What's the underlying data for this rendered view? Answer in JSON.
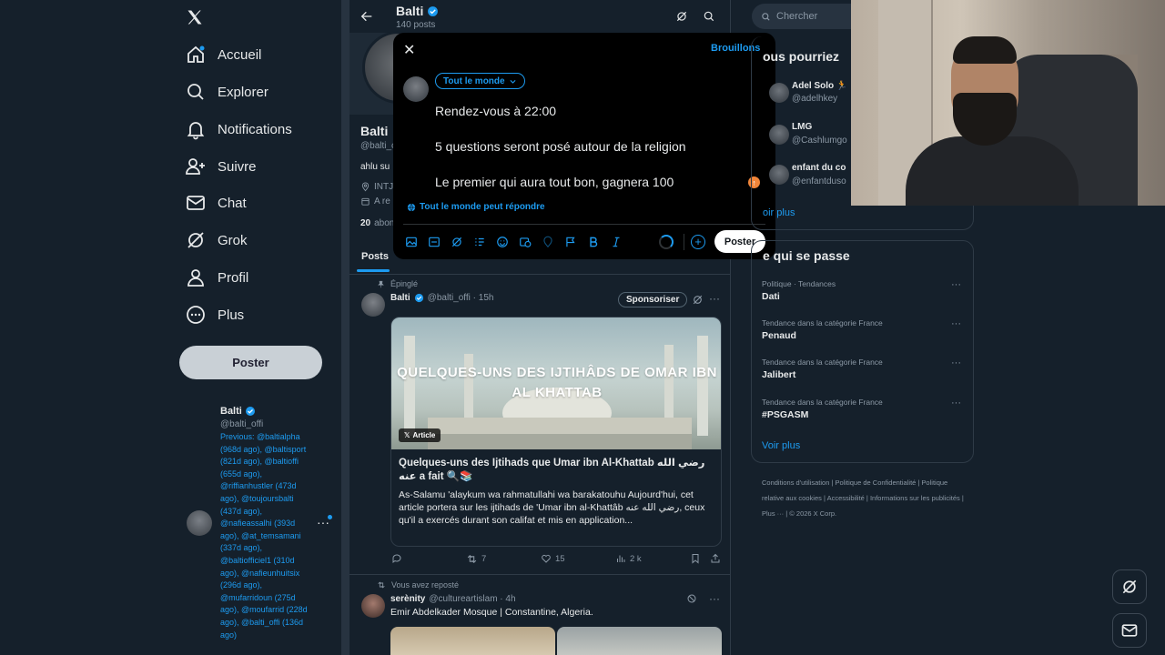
{
  "nav": {
    "items": [
      {
        "label": "Accueil",
        "icon": "home-icon"
      },
      {
        "label": "Explorer",
        "icon": "search-icon"
      },
      {
        "label": "Notifications",
        "icon": "bell-icon"
      },
      {
        "label": "Suivre",
        "icon": "add-person-icon"
      },
      {
        "label": "Chat",
        "icon": "mail-icon"
      },
      {
        "label": "Grok",
        "icon": "grok-icon"
      },
      {
        "label": "Profil",
        "icon": "person-icon"
      },
      {
        "label": "Plus",
        "icon": "more-circle-icon"
      }
    ],
    "post_button": "Poster"
  },
  "account": {
    "name": "Balti",
    "handle": "@balti_offi",
    "previous": "Previous: @baltialpha (968d ago), @baltisport (821d ago), @baltioffi (655d ago), @riffianhustler (473d ago), @toujoursbalti (437d ago), @nafieassalhi (393d ago), @at_temsamani (337d ago), @baltiofficiel1 (310d ago), @nafieunhuitsix (296d ago), @mufarridoun (275d ago), @moufarrid (228d ago), @balti_offi (136d ago)"
  },
  "profile": {
    "header_name": "Balti",
    "post_count": "140 posts",
    "display_name_partial": "Balti",
    "handle_partial": "@balti_c",
    "bio_partial": "ahlu su",
    "location_partial": "INTJ",
    "joined_partial": "A re",
    "following_partial": "20",
    "following_label_partial": "abon",
    "tab_posts": "Posts"
  },
  "compose": {
    "drafts": "Brouillons",
    "audience": "Tout le monde",
    "lines": [
      "Rendez-vous à 22:00",
      "5 questions seront posé autour de la religion",
      "Le premier qui aura tout bon, gagnera 100"
    ],
    "reply_setting": "Tout le monde peut répondre",
    "post_button": "Poster"
  },
  "pinned_post": {
    "pinned_label": "Épinglé",
    "name": "Balti",
    "handle_time": "@balti_offi · 15h",
    "sponsor_label": "Sponsoriser",
    "article_image_title": "QUELQUES-UNS DES IJTIHÂDS DE OMAR IBN AL KHATTAB",
    "article_badge": "Article",
    "article_title": "Quelques-uns des Ijtihads que Umar ibn Al-Khattab رضي الله عنه a fait 🔍📚",
    "article_body": "As-Salamu 'alaykum wa rahmatullahi wa barakatouhu Aujourd'hui, cet article portera sur les ijtihads de 'Umar ibn al-Khattâb رضي الله عنه, ceux qu'il a exercés durant son califat et mis en application...",
    "reposts": "7",
    "likes": "15",
    "views": "2 k"
  },
  "second_post": {
    "repost_label": "Vous avez reposté",
    "name": "serènity",
    "handle_time": "@cultureartislam · 4h",
    "text": "Emir Abdelkader Mosque | Constantine, Algeria."
  },
  "right": {
    "search_placeholder": "Chercher",
    "suggestions_title": "ous pourriez",
    "suggestions": [
      {
        "name": "Adel Solo 🏃",
        "handle": "@adelhkey"
      },
      {
        "name": "LMG",
        "handle": "@Cashlumgo"
      },
      {
        "name": "enfant du co",
        "handle": "@enfantduso"
      }
    ],
    "suggestions_more": "oir plus",
    "trends_title": "e qui se passe",
    "trends": [
      {
        "category": "Politique · Tendances",
        "name": "Dati"
      },
      {
        "category": "Tendance dans la catégorie France",
        "name": "Penaud"
      },
      {
        "category": "Tendance dans la catégorie France",
        "name": "Jalibert"
      },
      {
        "category": "Tendance dans la catégorie France",
        "name": "#PSGASM"
      }
    ],
    "trends_more": "Voir plus",
    "footer": "Conditions d'utilisation | Politique de Confidentialité | Politique relative aux cookies | Accessibilité | Informations sur les publicités | Plus ··· | © 2026 X Corp."
  },
  "colors": {
    "background": "#15202b",
    "accent": "#1d9bf0",
    "modal": "#000000"
  }
}
